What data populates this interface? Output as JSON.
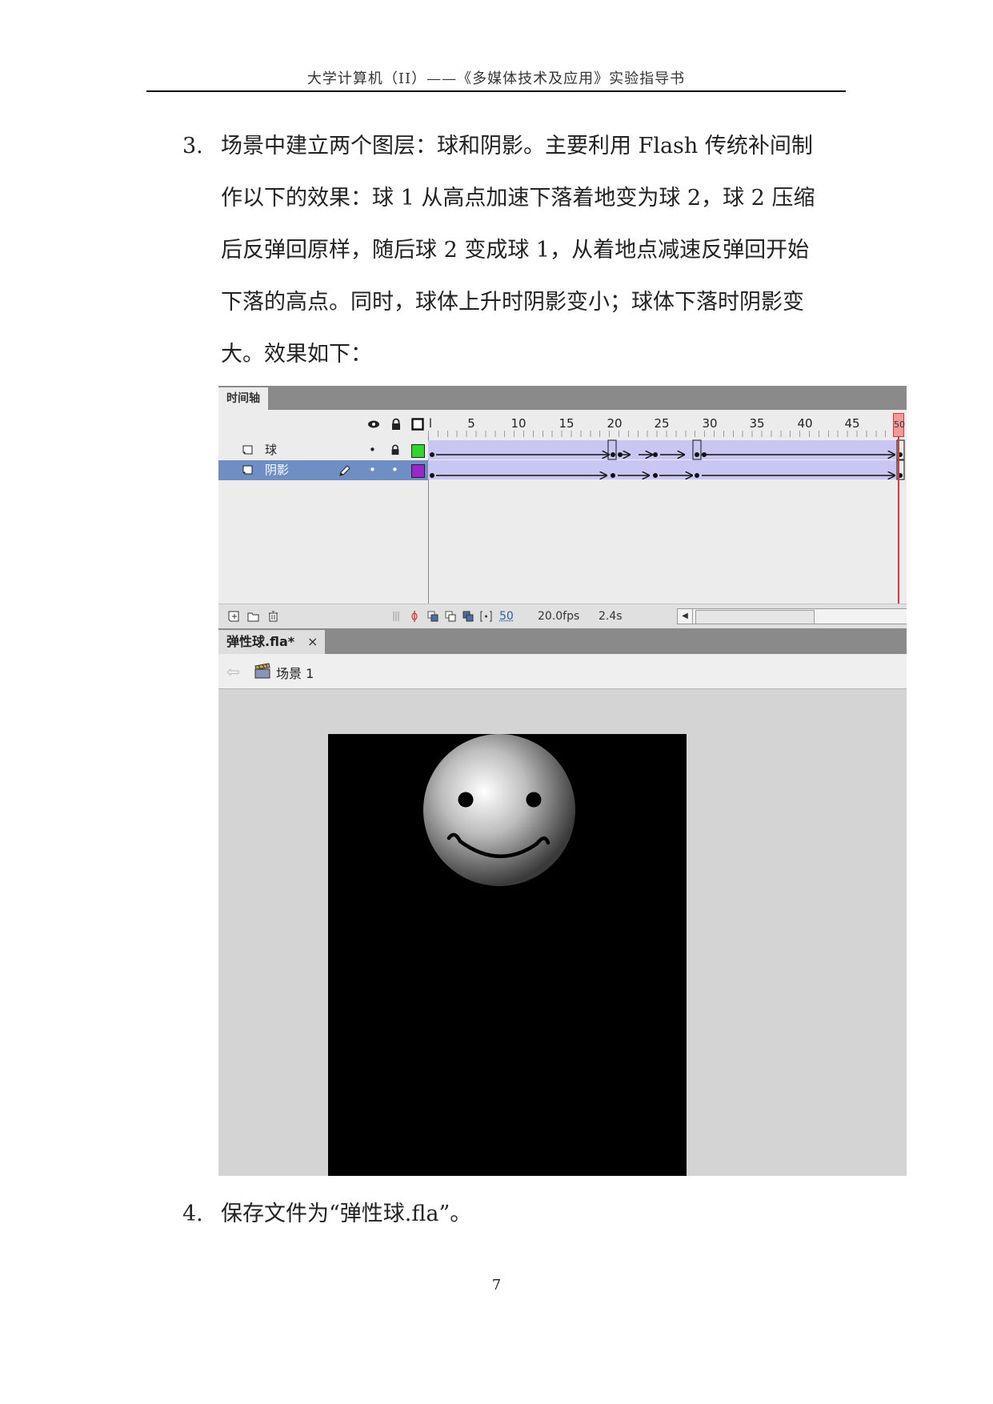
{
  "page_header": "大学计算机（II）——《多媒体技术及应用》实验指导书",
  "item3": {
    "number": "3.",
    "lines": [
      "场景中建立两个图层：球和阴影。主要利用 Flash 传统补间制",
      "作以下的效果：球 1 从高点加速下落着地变为球 2，球 2 压缩",
      "后反弹回原样，随后球 2 变成球 1，从着地点减速反弹回开始",
      "下落的高点。同时，球体上升时阴影变小；球体下落时阴影变",
      "大。效果如下："
    ]
  },
  "flash": {
    "timeline_tab": "时间轴",
    "ruler_numbers": [
      "l",
      "5",
      "10",
      "15",
      "20",
      "25",
      "30",
      "35",
      "40",
      "45",
      "50"
    ],
    "layers": [
      {
        "name": "球",
        "selected": false,
        "color": "#2ed62e",
        "eye": "•",
        "lock": "lock-icon"
      },
      {
        "name": "阴影",
        "selected": true,
        "color": "#9b26c9",
        "eye": "•",
        "lock": "•"
      }
    ],
    "current_frame": "50",
    "fps_value": "20.0",
    "fps_unit": "fps",
    "elapsed_value": "2.4",
    "elapsed_unit": "s",
    "document_tab": "弹性球.fla*",
    "close_symbol": "×",
    "scene_label": "场景 1",
    "stage_color": "#000000",
    "layer_highlight_color": "#6f8ec4",
    "tween_color": "#c9c6f3",
    "playhead_color": "#d23c3c"
  },
  "item4": {
    "number": "4.",
    "text": "保存文件为“弹性球.fla”。"
  },
  "page_number": "7"
}
